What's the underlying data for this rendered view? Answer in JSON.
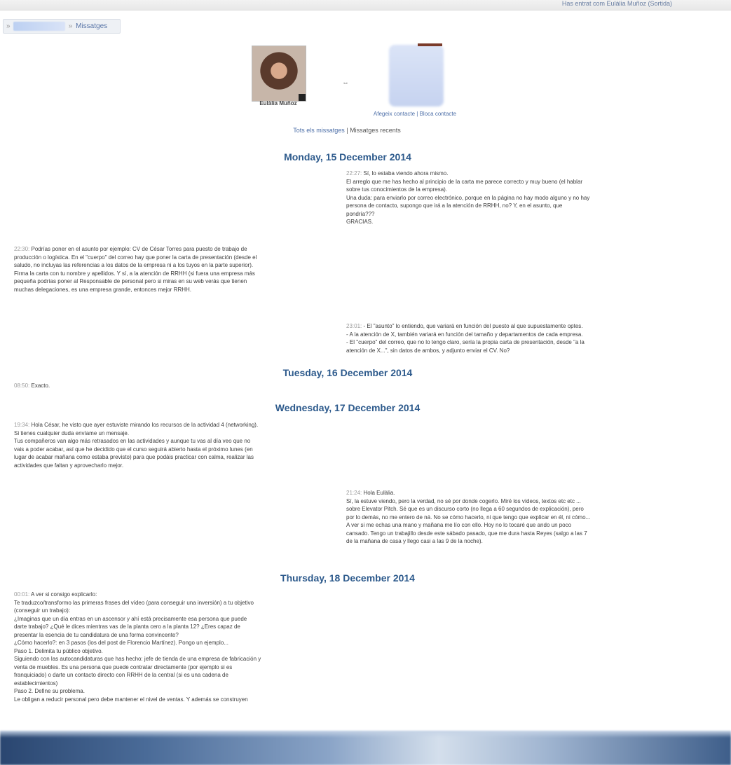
{
  "topbar": {
    "login_text": "Has entrat com Eulàlia Muñoz (Sortida)"
  },
  "breadcrumb": {
    "lead": "»",
    "current": "Missatges",
    "separator": "»"
  },
  "participants": {
    "left_name": "Eulàlia Muñoz",
    "badge": "",
    "arrow": "⇔",
    "contact_links": "Afegeix contacte | Bloca contacte"
  },
  "filters": {
    "all": "Tots els missatges",
    "separator": "|",
    "recent": "Missatges recents"
  },
  "days": [
    "Monday, 15 December 2014",
    "Tuesday, 16 December 2014",
    "Wednesday, 17 December 2014",
    "Thursday, 18 December 2014"
  ],
  "messages": {
    "m1": {
      "time": "22:27:",
      "lines": [
        "Sí, lo estaba viendo ahora mismo.",
        "El arreglo que me has hecho al principio de la carta me parece correcto y muy bueno (el hablar",
        "sobre tus conocimientos de la empresa).",
        "Una duda: para enviarlo por correo electrónico, porque en la página no hay modo alguno y no hay",
        "persona de contacto, supongo que irá a la atención de RRHH, no? Y, en el asunto, que",
        "pondría???",
        "GRACIAS."
      ]
    },
    "m2": {
      "time": "22:30:",
      "lines": [
        "Podrías poner en el asunto por ejemplo: CV de César Torres para puesto de trabajo de",
        "producción o logística. En el \"cuerpo\" del correo hay que poner la carta de presentación (desde el",
        "saludo, no incluyas las referencias a los datos de la empresa ni a los tuyos en la parte superior).",
        "Firma la carta con tu nombre y apellidos. Y sí, a la atención de RRHH (si fuera una empresa más",
        "pequeña podrías poner al Responsable de personal pero si miras en su web verás que tienen",
        "muchas delegaciones, es una empresa grande, entonces mejor RRHH."
      ]
    },
    "m3": {
      "time": "23:01:",
      "lines": [
        "- El \"asunto\" lo entiendo, que variará en función del puesto al que supuestamente optes.",
        "- A la atención de X, también variará en función del tamaño y departamentos de cada empresa.",
        "- El \"cuerpo\" del correo, que no lo tengo claro, sería la propia carta de presentación, desde \"a la",
        "atención de X...\", sin datos de ambos, y adjunto enviar el CV. No?"
      ]
    },
    "m4": {
      "time": "08:50:",
      "lines": [
        "Exacto."
      ]
    },
    "m5": {
      "time": "19:34:",
      "lines": [
        "Hola César, he visto que ayer estuviste mirando los recursos de la actividad 4 (networking).",
        "Si tienes cualquier duda envíame un mensaje.",
        "Tus compañeros van algo más retrasados en las actividades y aunque tu vas al día veo que no",
        "vais a poder acabar, así que he decidido que el curso seguirá abierto hasta el próximo lunes (en",
        "lugar de acabar mañana como estaba previsto) para que podáis practicar con calma, realizar las",
        "actividades que faltan y aprovecharlo mejor."
      ]
    },
    "m6": {
      "time": "21:24:",
      "lines": [
        "Hola Eulàlia.",
        "Sí, la estuve viendo, pero la verdad, no sé por donde cogerlo. Miré los vídeos, textos etc etc ...",
        "sobre Elevator Pitch. Sé que es un discurso corto (no llega a 60 segundos de explicación), pero",
        "por lo demás, no me entero de ná. No se cómo hacerlo, ni que tengo que explicar en él, ni cómo...",
        "A ver si me echas una mano y mañana me lío con ello. Hoy no lo tocaré que ando un poco",
        "cansado. Tengo un trabajillo desde este sábado pasado, que me dura hasta Reyes (salgo a las 7",
        "de la mañana de casa y llego casi a las 9 de la noche)."
      ]
    },
    "m7": {
      "time": "00:01:",
      "lines": [
        "A ver si consigo explicarlo:",
        "Te traduzco/transformo las primeras frases del vídeo (para conseguir una inversión) a tu objetivo",
        "(conseguir un trabajo):",
        "¿Imaginas que un día entras en un ascensor y ahí está precisamente esa persona que puede",
        "darte trabajo? ¿Qué le dices mientras vas de la planta cero a la planta 12? ¿Eres capaz de",
        "presentar la esencia de tu candidatura de una forma convincente?",
        "¿Cómo hacerlo?: en 3 pasos (los del post de Florencio Martínez). Pongo un ejemplo...",
        "Paso 1. Delimita tu público objetivo.",
        "Siguiendo con las autocandidaturas que has hecho: jefe de tienda de una empresa de fabricación y",
        "venta de muebles. Es una persona que puede contratar directamente (por ejemplo si es",
        "franquiciado) o darte un contacto directo con RRHH de la central (si es una cadena de",
        "establecimientos)",
        "Paso 2. Define su problema.",
        "Le obligan a reducir personal pero debe mantener el nivel de ventas. Y además se construyen"
      ]
    }
  }
}
